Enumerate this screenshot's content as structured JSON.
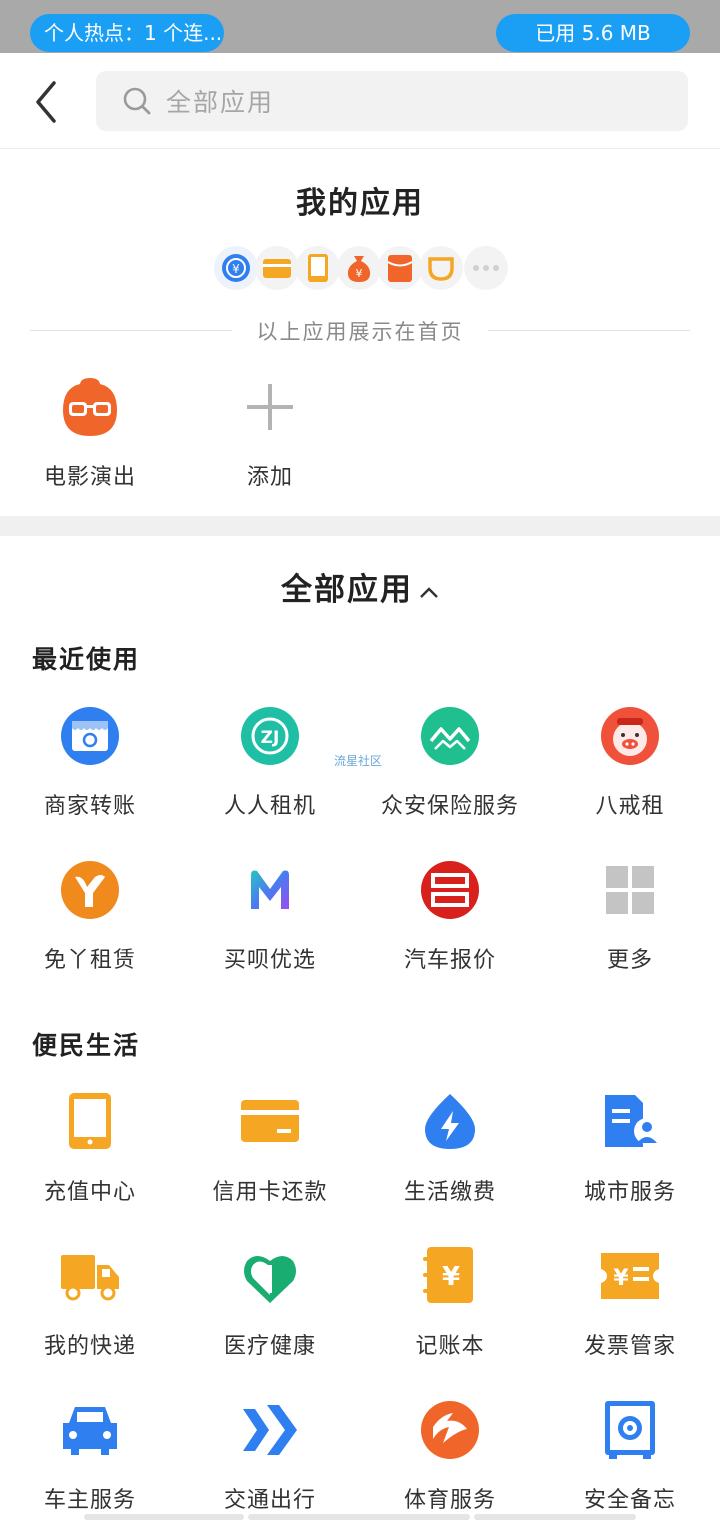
{
  "status_bar": {
    "hotspot_text": "个人热点：1 个连...",
    "data_used": "已用 5.6 MB"
  },
  "header": {
    "search_placeholder": "全部应用"
  },
  "my_apps": {
    "title": "我的应用",
    "home_icons": [
      "yuan-circle-icon",
      "card-icon",
      "phone-icon",
      "money-bag-icon",
      "red-envelope-icon",
      "cup-icon",
      "more-dots-icon"
    ],
    "divider_text": "以上应用展示在首页",
    "apps": [
      {
        "label": "电影演出",
        "icon": "movie-glasses-icon"
      },
      {
        "label": "添加",
        "icon": "plus-icon"
      }
    ]
  },
  "all_apps": {
    "title": "全部应用",
    "recent": {
      "heading": "最近使用",
      "apps": [
        {
          "label": "商家转账",
          "icon": "shop-transfer-icon"
        },
        {
          "label": "人人租机",
          "icon": "rrzj-icon"
        },
        {
          "label": "众安保险服务",
          "icon": "zhongan-icon"
        },
        {
          "label": "八戒租",
          "icon": "pig-icon"
        },
        {
          "label": "免丫租赁",
          "icon": "mianya-icon"
        },
        {
          "label": "买呗优选",
          "icon": "m-logo-icon"
        },
        {
          "label": "汽车报价",
          "icon": "car-price-icon"
        },
        {
          "label": "更多",
          "icon": "grid-more-icon"
        }
      ]
    },
    "watermark": "流星社区",
    "life": {
      "heading": "便民生活",
      "apps": [
        {
          "label": "充值中心",
          "icon": "tablet-icon"
        },
        {
          "label": "信用卡还款",
          "icon": "credit-card-icon"
        },
        {
          "label": "生活缴费",
          "icon": "lightning-drop-icon"
        },
        {
          "label": "城市服务",
          "icon": "city-doc-icon"
        },
        {
          "label": "我的快递",
          "icon": "truck-icon"
        },
        {
          "label": "医疗健康",
          "icon": "medical-heart-icon"
        },
        {
          "label": "记账本",
          "icon": "notebook-yuan-icon"
        },
        {
          "label": "发票管家",
          "icon": "invoice-icon"
        },
        {
          "label": "车主服务",
          "icon": "car-icon"
        },
        {
          "label": "交通出行",
          "icon": "double-arrow-icon"
        },
        {
          "label": "体育服务",
          "icon": "sports-icon"
        },
        {
          "label": "安全备忘",
          "icon": "safe-icon"
        }
      ]
    }
  },
  "colors": {
    "accent_blue": "#1a9ff5",
    "orange": "#f5a623",
    "red_orange": "#f0662a",
    "teal": "#1fbfa6",
    "icon_blue": "#2f7ff0",
    "green": "#1aad72"
  }
}
